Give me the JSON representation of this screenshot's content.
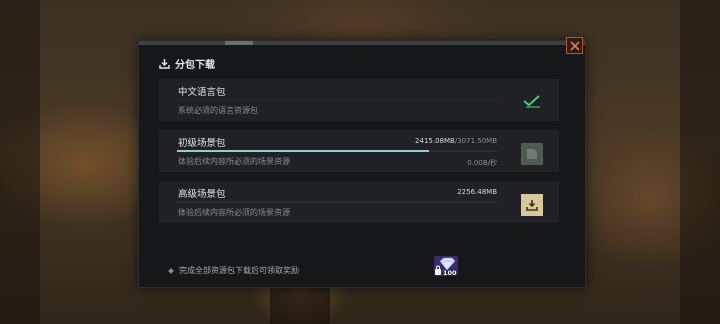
{
  "dialog": {
    "title": "分包下载",
    "close_icon": "close-icon",
    "title_icon": "download-icon"
  },
  "packages": [
    {
      "name": "中文语言包",
      "description": "系统必须的语言资源包",
      "status": "installed",
      "status_icon": "check-icon",
      "status_color": "#4fc97a"
    },
    {
      "name": "初级场景包",
      "description": "体验后续内容所必须的场景资源",
      "downloaded": "2415.08MB",
      "separator": "/",
      "total": "3071.50MB",
      "speed": "0.00B/秒",
      "progress": 0.786,
      "status": "paused",
      "status_icon": "pause-icon",
      "progress_color": "#8fd0c6"
    },
    {
      "name": "高级场景包",
      "description": "体验后续内容所必须的场景资源",
      "size": "2256.48MB",
      "status": "not-downloaded",
      "status_icon": "download-icon",
      "button_color": "#d9c89a"
    }
  ],
  "footer": {
    "note": "完成全部资源包下载后可领取奖励",
    "reward_count": "100",
    "reward_icon": "diamond-icon"
  }
}
